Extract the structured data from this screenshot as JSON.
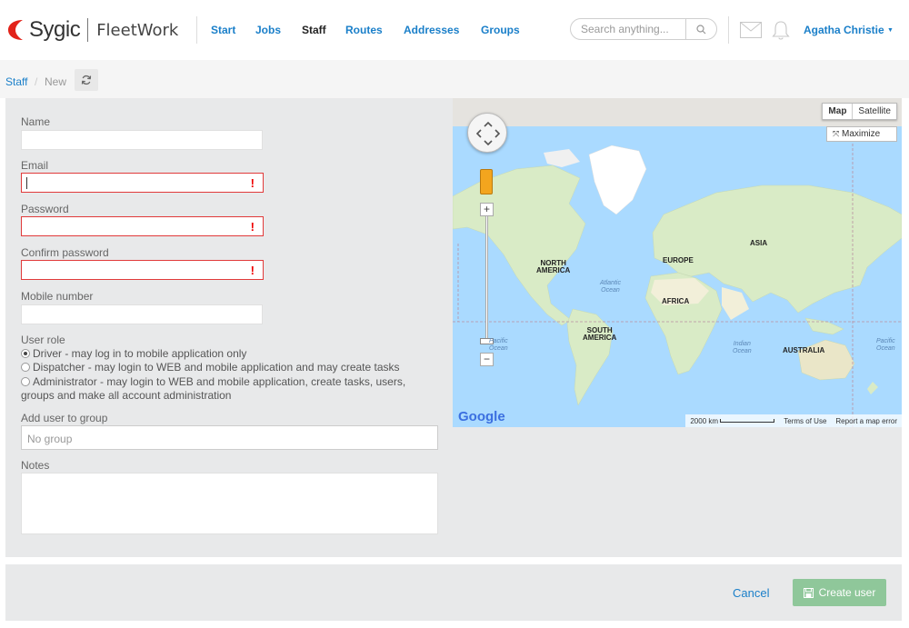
{
  "header": {
    "logo_brand": "Sygic",
    "logo_product": "FleetWork",
    "nav": [
      {
        "label": "Start",
        "active": false
      },
      {
        "label": "Jobs",
        "active": false
      },
      {
        "label": "Staff",
        "active": true
      },
      {
        "label": "Routes",
        "active": false
      },
      {
        "label": "Addresses",
        "active": false
      },
      {
        "label": "Groups",
        "active": false
      }
    ],
    "search_placeholder": "Search anything...",
    "user_name": "Agatha Christie",
    "icons": [
      "search-icon",
      "mail-icon",
      "bell-icon",
      "caret-down-icon"
    ]
  },
  "breadcrumb": {
    "root": "Staff",
    "separator": "/",
    "current": "New"
  },
  "form": {
    "name_label": "Name",
    "name_value": "",
    "email_label": "Email",
    "email_value": "",
    "password_label": "Password",
    "confirm_label": "Confirm password",
    "mobile_label": "Mobile number",
    "mobile_value": "",
    "error_mark": "!",
    "role_label": "User role",
    "roles": [
      {
        "label": "Driver - may log in to mobile application only",
        "selected": true
      },
      {
        "label": "Dispatcher - may login to WEB and mobile application and may create tasks",
        "selected": false
      },
      {
        "label": "Administrator - may login to WEB and mobile application, create tasks, users, groups and make all account administration",
        "selected": false
      }
    ],
    "group_label": "Add user to group",
    "group_value": "No group",
    "notes_label": "Notes",
    "notes_value": ""
  },
  "map": {
    "type_buttons": [
      "Map",
      "Satellite"
    ],
    "active_type": "Map",
    "maximize_label": "Maximize",
    "zoom_in": "+",
    "zoom_out": "−",
    "labels": {
      "asia": "ASIA",
      "europe": "EUROPE",
      "north_america_1": "NORTH",
      "north_america_2": "AMERICA",
      "africa": "AFRICA",
      "south_america_1": "SOUTH",
      "south_america_2": "AMERICA",
      "australia": "AUSTRALIA",
      "atlantic_1": "Atlantic",
      "atlantic_2": "Ocean",
      "indian_1": "Indian",
      "indian_2": "Ocean",
      "pacific_left_1": "Pacific",
      "pacific_left_2": "Ocean",
      "pacific_right_1": "Pacific",
      "pacific_right_2": "Ocean"
    },
    "google_logo": "Google",
    "scale": "2000 km",
    "terms": "Terms of Use",
    "report": "Report a map error"
  },
  "footer": {
    "cancel_label": "Cancel",
    "create_label": "Create user"
  },
  "colors": {
    "link_blue": "#1a7fc9",
    "error_red": "#e13a3a",
    "create_button": "#8fc79a",
    "panel_bg": "#e8e9ea",
    "water": "#aadaff",
    "land": "#d9ebc6"
  }
}
